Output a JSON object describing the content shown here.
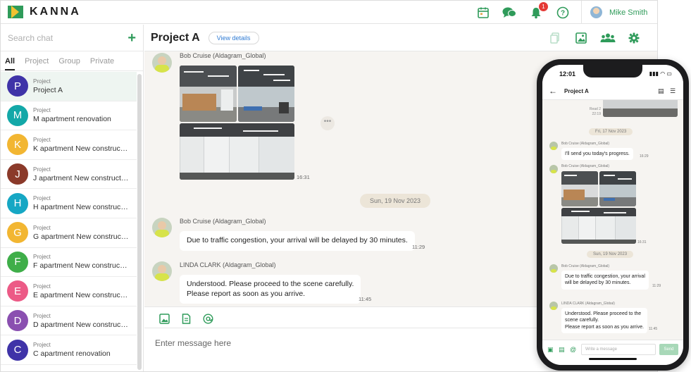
{
  "brand": {
    "name": "KANNA",
    "accent": "#2f9b5a"
  },
  "topbar": {
    "notification_count": "1",
    "user_name": "Mike Smith"
  },
  "sidebar": {
    "search_placeholder": "Search chat",
    "tabs": [
      "All",
      "Project",
      "Group",
      "Private"
    ],
    "active_tab": "All",
    "chats": [
      {
        "initial": "P",
        "kind": "Project",
        "name": "Project A",
        "color": "#3f33a8"
      },
      {
        "initial": "M",
        "kind": "Project",
        "name": "M apartment renovation",
        "color": "#13a8a8"
      },
      {
        "initial": "K",
        "kind": "Project",
        "name": "K apartment New construction",
        "color": "#f2b632"
      },
      {
        "initial": "J",
        "kind": "Project",
        "name": "J apartment New construction",
        "color": "#8b3a2a"
      },
      {
        "initial": "H",
        "kind": "Project",
        "name": "H apartment New construction",
        "color": "#16a7c4"
      },
      {
        "initial": "G",
        "kind": "Project",
        "name": "G apartment New construction",
        "color": "#f2b632"
      },
      {
        "initial": "F",
        "kind": "Project",
        "name": "F apartment New construction",
        "color": "#3fae49"
      },
      {
        "initial": "E",
        "kind": "Project",
        "name": "E apartment New construction",
        "color": "#ec5a86"
      },
      {
        "initial": "D",
        "kind": "Project",
        "name": "D apartment New construction",
        "color": "#8a4fb0"
      },
      {
        "initial": "C",
        "kind": "Project",
        "name": "C apartment renovation",
        "color": "#3f33a8"
      }
    ]
  },
  "room": {
    "title": "Project A",
    "view_details": "View details"
  },
  "messages": {
    "photo_sender": "Bob Cruise (Aldagram_Global)",
    "photo_time": "16:31",
    "date_chip": "Sun, 19 Nov 2023",
    "msg1_sender": "Bob Cruise (Aldagram_Global)",
    "msg1_text": "Due to traffic congestion, your arrival will be delayed by 30 minutes.",
    "msg1_time": "11:29",
    "msg2_sender": "LINDA CLARK (Aldagram_Global)",
    "msg2_line1": "Understood. Please proceed to the scene carefully.",
    "msg2_line2": "Please report as soon as you arrive.",
    "msg2_time": "11:45"
  },
  "composer": {
    "placeholder": "Enter message here"
  },
  "phone": {
    "clock": "12:01",
    "title": "Project A",
    "read_label": "Read 2",
    "read_time": "22:19",
    "date1": "Fri, 17 Nov 2023",
    "sender1": "Bob Cruise (Aldagram_Global)",
    "text1": "I'll send you today's progress.",
    "time1": "16:29",
    "sender2": "Bob Cruise (Aldagram_Global)",
    "photo_time": "16:31",
    "date2": "Sun, 19 Nov 2023",
    "sender3": "Bob Cruise (Aldagram_Global)",
    "text3_line1": "Due to traffic congestion, your arrival",
    "text3_line2": "will be delayed by 30 minutes.",
    "time3": "11:29",
    "sender4": "LINDA CLARK (Aldagram_Global)",
    "text4_line1": "Understood. Please proceed to the",
    "text4_line2": "scene carefully.",
    "text4_line3": "Please report as soon as you arrive.",
    "time4": "11:45",
    "input_placeholder": "Write a message",
    "send_label": "Send"
  }
}
